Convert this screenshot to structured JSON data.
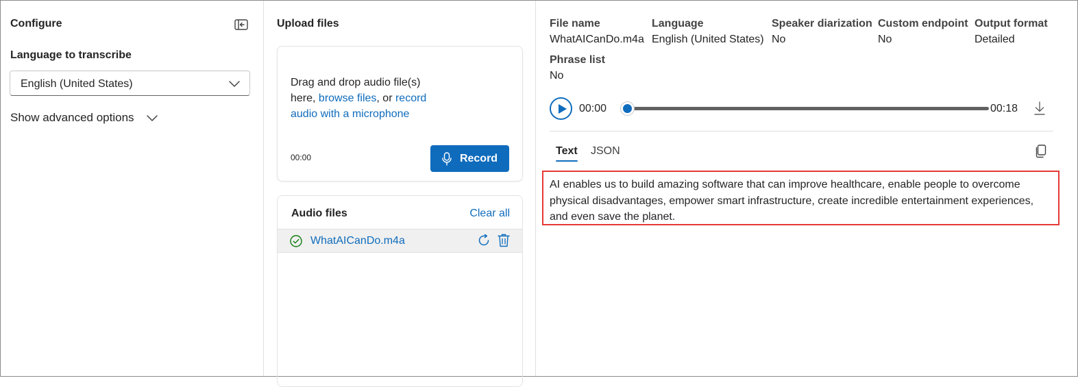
{
  "configure": {
    "title": "Configure",
    "language_label": "Language to transcribe",
    "language_value": "English (United States)",
    "advanced_toggle": "Show advanced options"
  },
  "upload": {
    "title": "Upload files",
    "drop_text_1": "Drag and drop audio file(s) here, ",
    "browse_link": "browse files",
    "drop_text_2": ", or ",
    "record_link": "record audio with a microphone",
    "timer": "00:00",
    "record_button": "Record"
  },
  "audio_files": {
    "title": "Audio files",
    "clear_all": "Clear all",
    "items": [
      {
        "name": "WhatAICanDo.m4a"
      }
    ]
  },
  "details": {
    "file_name_label": "File name",
    "file_name_value": "WhatAICanDo.m4a",
    "language_label": "Language",
    "language_value": "English (United States)",
    "diarization_label": "Speaker diarization",
    "diarization_value": "No",
    "endpoint_label": "Custom endpoint",
    "endpoint_value": "No",
    "format_label": "Output format",
    "format_value": "Detailed",
    "phrase_label": "Phrase list",
    "phrase_value": "No"
  },
  "player": {
    "current_time": "00:00",
    "duration": "00:18",
    "progress": 0
  },
  "result_tabs": {
    "text": "Text",
    "json": "JSON",
    "active": "Text"
  },
  "transcript": "AI enables us to build amazing software that can improve healthcare, enable people to overcome physical disadvantages, empower smart infrastructure, create incredible entertainment experiences, and even save the planet.",
  "colors": {
    "accent": "#0f6cbd",
    "highlight_border": "#e53935",
    "success": "#107c10"
  }
}
